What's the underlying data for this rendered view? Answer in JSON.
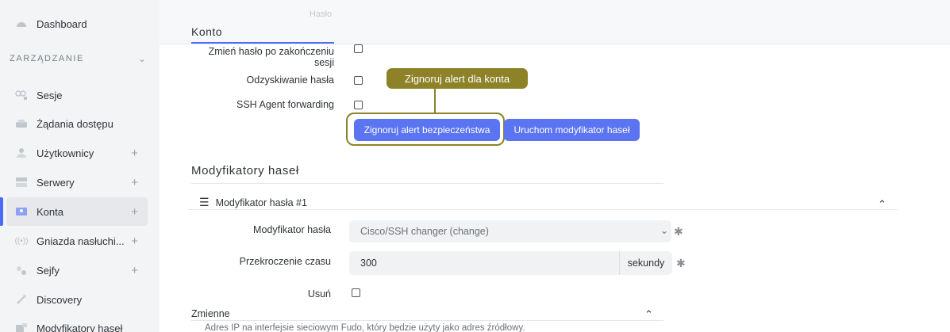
{
  "sidebar": {
    "section_title": "ZARZĄDZANIE",
    "items": [
      {
        "label": "Dashboard",
        "icon": "dashboard-icon",
        "plus": false,
        "active": false
      },
      {
        "label": "Sesje",
        "icon": "sessions-icon",
        "plus": false,
        "active": false
      },
      {
        "label": "Żądania dostępu",
        "icon": "access-requests-icon",
        "plus": false,
        "active": false
      },
      {
        "label": "Użytkownicy",
        "icon": "users-icon",
        "plus": true,
        "active": false
      },
      {
        "label": "Serwery",
        "icon": "servers-icon",
        "plus": true,
        "active": false
      },
      {
        "label": "Konta",
        "icon": "accounts-icon",
        "plus": true,
        "active": true
      },
      {
        "label": "Gniazda nasłuchi...",
        "icon": "listeners-icon",
        "plus": true,
        "active": false
      },
      {
        "label": "Sejfy",
        "icon": "safes-icon",
        "plus": true,
        "active": false
      },
      {
        "label": "Discovery",
        "icon": "discovery-icon",
        "plus": false,
        "active": false
      },
      {
        "label": "Modyfikatory haseł",
        "icon": "password-modifiers-icon",
        "plus": false,
        "active": false
      }
    ]
  },
  "header": {
    "ghost_text": "Hasło",
    "tab_label": "Konto"
  },
  "form": {
    "change_password_label_line1": "Zmień hasło po zakończeniu",
    "change_password_label_line2": "sesji",
    "password_recovery_label": "Odzyskiwanie hasła",
    "ssh_agent_label": "SSH Agent forwarding",
    "ignore_alert_button": "Zignoruj alert bezpieczeństwa",
    "run_modifier_button": "Uruchom modyfikator haseł"
  },
  "tooltip": {
    "text": "Zignoruj alert dla konta"
  },
  "modifiers": {
    "section_title": "Modyfikatory haseł",
    "item_title": "Modyfikator hasła #1",
    "modifier_label": "Modyfikator hasła",
    "modifier_value": "Cisco/SSH changer (change)",
    "timeout_label": "Przekroczenie czasu",
    "timeout_value": "300",
    "timeout_unit": "sekundy",
    "delete_label": "Usuń",
    "variables_title": "Zmienne",
    "address_hint": "Adres IP na interfejsie sieciowym Fudo, który będzie użyty jako adres źródłowy."
  },
  "colors": {
    "accent": "#5b74f1",
    "callout": "#8d8228",
    "sidebar_bg": "#f3f4f6"
  }
}
